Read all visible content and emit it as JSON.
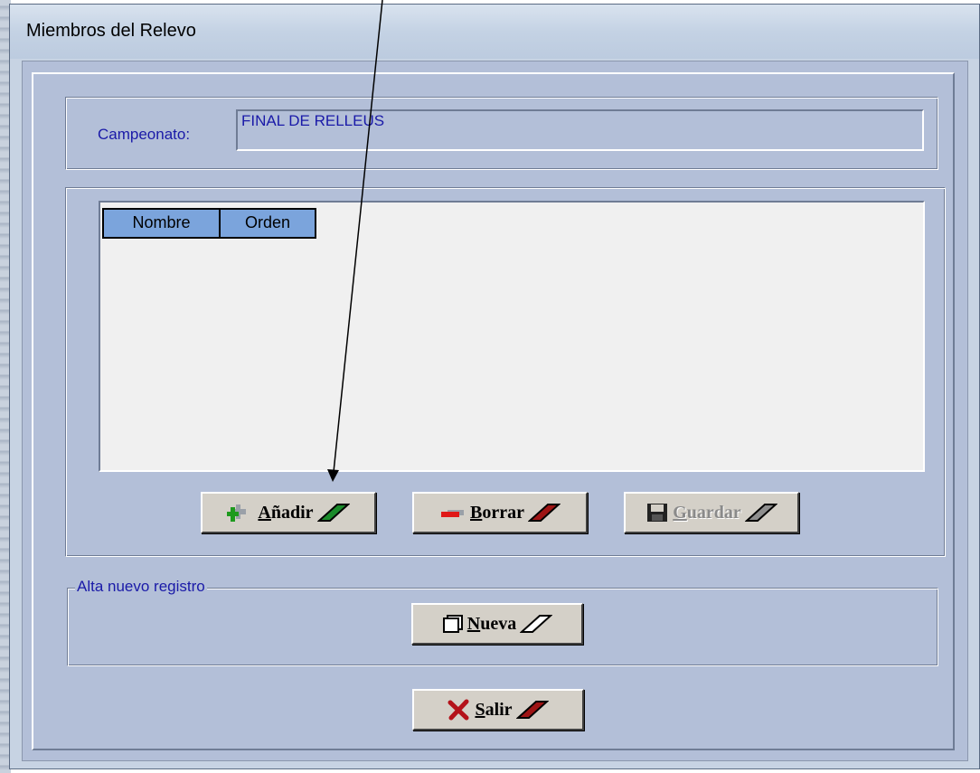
{
  "window": {
    "title": "Miembros del Relevo"
  },
  "campeonato": {
    "label": "Campeonato:",
    "value": "FINAL DE RELLEUS"
  },
  "grid": {
    "columns": [
      "Nombre",
      "Orden"
    ]
  },
  "buttons": {
    "anadir": "Añadir",
    "borrar": "Borrar",
    "guardar": "Guardar",
    "nueva": "Nueva",
    "salir": "Salir"
  },
  "alta_group": {
    "legend": "Alta nuevo registro"
  },
  "colors": {
    "accent_blue": "#1a1aa8",
    "header_blue": "#7ba4dc",
    "panel": "#b3bfd8"
  },
  "icons": [
    "plus-icon",
    "minus-icon",
    "floppy-disk-icon",
    "new-page-icon",
    "close-x-icon",
    "slash-icon"
  ]
}
